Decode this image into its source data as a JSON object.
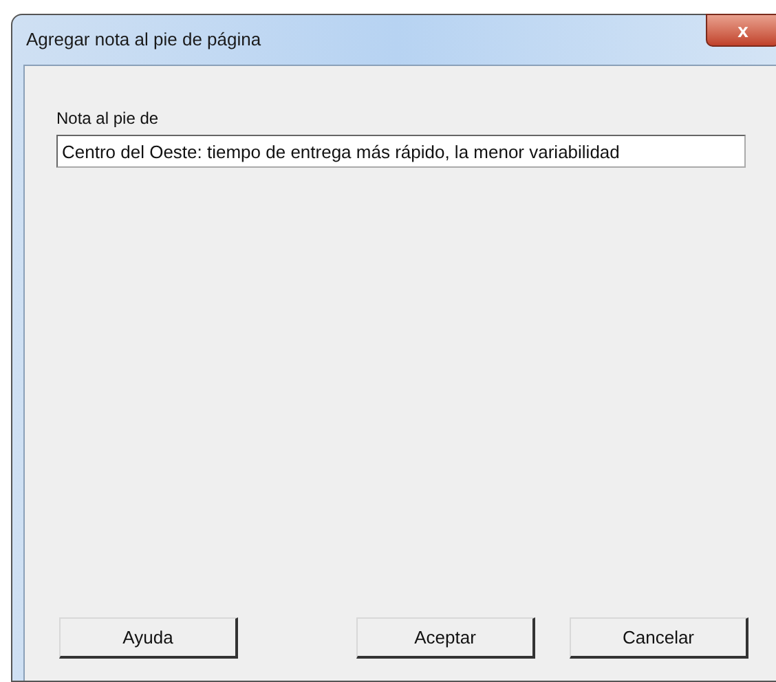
{
  "window": {
    "title": "Agregar nota al pie de página",
    "close": "x"
  },
  "field": {
    "label": "Nota al pie de",
    "value": "Centro del Oeste: tiempo de entrega más rápido, la menor variabilidad"
  },
  "buttons": [
    {
      "label": "Ayuda",
      "kind": "help"
    },
    {
      "label": "Aceptar",
      "kind": "ok"
    },
    {
      "label": "Cancelar",
      "kind": "cancel"
    }
  ]
}
